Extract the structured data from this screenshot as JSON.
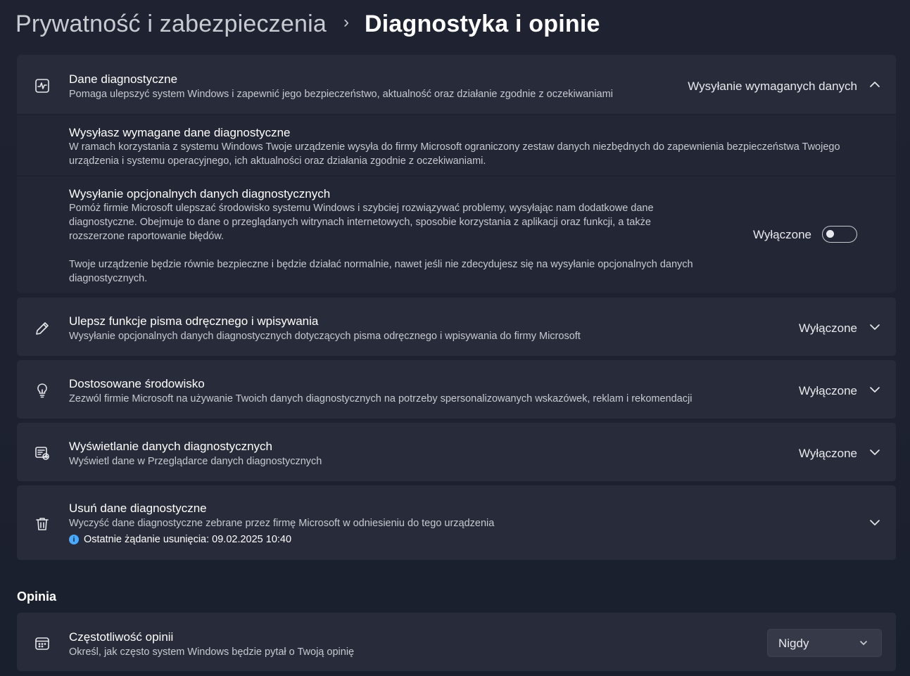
{
  "breadcrumb": {
    "parent": "Prywatność i zabezpieczenia",
    "separator": "›",
    "current": "Diagnostyka i opinie"
  },
  "diagnostic_data": {
    "title": "Dane diagnostyczne",
    "description": "Pomaga ulepszyć system Windows i zapewnić jego bezpieczeństwo, aktualność oraz działanie zgodnie z oczekiwaniami",
    "value": "Wysyłanie wymaganych danych",
    "icon": "diagnostics-pulse-icon",
    "expanded": true,
    "required": {
      "title": "Wysyłasz wymagane dane diagnostyczne",
      "description": "W ramach korzystania z systemu Windows Twoje urządzenie wysyła do firmy Microsoft ograniczony zestaw danych niezbędnych do zapewnienia bezpieczeństwa Twojego urządzenia i systemu operacyjnego, ich aktualności oraz działania zgodnie z oczekiwaniami."
    },
    "optional": {
      "title": "Wysyłanie opcjonalnych danych diagnostycznych",
      "description": "Pomóż firmie Microsoft ulepszać środowisko systemu Windows i szybciej rozwiązywać problemy, wysyłając nam dodatkowe dane diagnostyczne. Obejmuje to dane o przeglądanych witrynach internetowych, sposobie korzystania z aplikacji oraz funkcji, a także rozszerzone raportowanie błędów.",
      "note": "Twoje urządzenie będzie równie bezpieczne i będzie działać normalnie, nawet jeśli nie zdecydujesz się na wysyłanie opcjonalnych danych diagnostycznych.",
      "toggle_label": "Wyłączone",
      "toggle_on": false
    }
  },
  "inking": {
    "title": "Ulepsz funkcje pisma odręcznego i wpisywania",
    "description": "Wysyłanie opcjonalnych danych diagnostycznych dotyczących pisma odręcznego i wpisywania do firmy Microsoft",
    "value": "Wyłączone",
    "icon": "pen-icon"
  },
  "tailored": {
    "title": "Dostosowane środowisko",
    "description": "Zezwól firmie Microsoft na używanie Twoich danych diagnostycznych na potrzeby spersonalizowanych wskazówek, reklam i rekomendacji",
    "value": "Wyłączone",
    "icon": "lightbulb-icon"
  },
  "viewer": {
    "title": "Wyświetlanie danych diagnostycznych",
    "description": "Wyświetl dane w Przeglądarce danych diagnostycznych",
    "value": "Wyłączone",
    "icon": "data-viewer-icon"
  },
  "delete": {
    "title": "Usuń dane diagnostyczne",
    "description": "Wyczyść dane diagnostyczne zebrane przez firmę Microsoft w odniesieniu do tego urządzenia",
    "info": "Ostatnie żądanie usunięcia: 09.02.2025 10:40",
    "icon": "trash-icon"
  },
  "feedback_section": {
    "heading": "Opinia",
    "frequency": {
      "title": "Częstotliwość opinii",
      "description": "Określ, jak często system Windows będzie pytał o Twoją opinię",
      "selected": "Nigdy",
      "icon": "calendar-icon"
    }
  },
  "colors": {
    "background": "#1e2230",
    "card": "#282c3a",
    "subcard": "#232735",
    "info_accent": "#4aa8ff"
  }
}
